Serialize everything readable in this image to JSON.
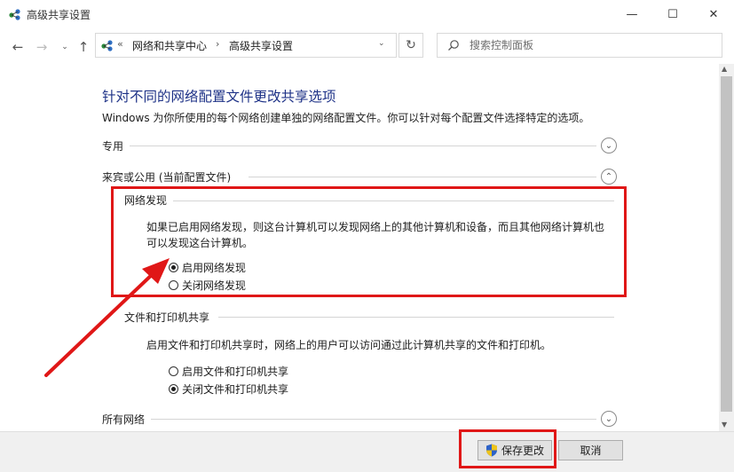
{
  "window": {
    "title": "高级共享设置"
  },
  "address": {
    "prefix": "«",
    "crumbs": [
      "网络和共享中心",
      "高级共享设置"
    ]
  },
  "search": {
    "placeholder": "搜索控制面板"
  },
  "main": {
    "heading": "针对不同的网络配置文件更改共享选项",
    "description": "Windows 为你所使用的每个网络创建单独的网络配置文件。你可以针对每个配置文件选择特定的选项。",
    "profiles": [
      {
        "label": "专用",
        "expanded": false
      },
      {
        "label": "来宾或公用 (当前配置文件)",
        "expanded": true
      },
      {
        "label": "所有网络",
        "expanded": false
      }
    ],
    "network_discovery": {
      "title": "网络发现",
      "text_line1": "如果已启用网络发现，则这台计算机可以发现网络上的其他计算机和设备，而且其他网络计算机也",
      "text_line2": "可以发现这台计算机。",
      "options": [
        {
          "label": "启用网络发现",
          "checked": true
        },
        {
          "label": "关闭网络发现",
          "checked": false
        }
      ]
    },
    "file_sharing": {
      "title": "文件和打印机共享",
      "text": "启用文件和打印机共享时，网络上的用户可以访问通过此计算机共享的文件和打印机。",
      "options": [
        {
          "label": "启用文件和打印机共享",
          "checked": false
        },
        {
          "label": "关闭文件和打印机共享",
          "checked": true
        }
      ]
    }
  },
  "footer": {
    "save_label": "保存更改",
    "cancel_label": "取消"
  },
  "colors": {
    "heading": "#1e3287",
    "annotation": "#e01717"
  },
  "icons": [
    "network-icon",
    "minimize-icon",
    "maximize-icon",
    "close-icon",
    "back-icon",
    "forward-icon",
    "recent-dropdown-icon",
    "up-icon",
    "refresh-icon",
    "search-icon",
    "expand-icon",
    "collapse-icon",
    "uac-shield-icon"
  ]
}
